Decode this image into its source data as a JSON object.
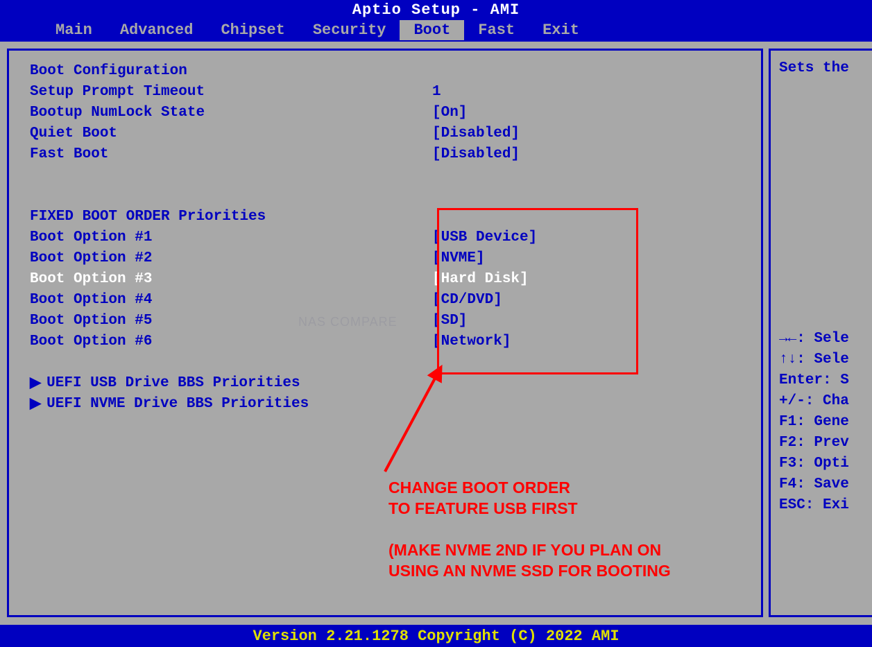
{
  "title": "Aptio Setup - AMI",
  "tabs": [
    "Main",
    "Advanced",
    "Chipset",
    "Security",
    "Boot",
    "Fast",
    "Exit"
  ],
  "active_tab": "Boot",
  "boot_config_title": "Boot Configuration",
  "settings": [
    {
      "label": "Setup Prompt Timeout",
      "value": "1"
    },
    {
      "label": "Bootup NumLock State",
      "value": "[On]"
    },
    {
      "label": "Quiet Boot",
      "value": "[Disabled]"
    },
    {
      "label": "Fast Boot",
      "value": "[Disabled]"
    }
  ],
  "fixed_boot_title": "FIXED BOOT ORDER Priorities",
  "boot_options": [
    {
      "label": "Boot Option #1",
      "value": "[USB Device]",
      "highlighted": false
    },
    {
      "label": "Boot Option #2",
      "value": "[NVME]",
      "highlighted": false
    },
    {
      "label": "Boot Option #3",
      "value": "[Hard Disk]",
      "highlighted": true
    },
    {
      "label": "Boot Option #4",
      "value": "[CD/DVD]",
      "highlighted": false
    },
    {
      "label": "Boot Option #5",
      "value": "[SD]",
      "highlighted": false
    },
    {
      "label": "Boot Option #6",
      "value": "[Network]",
      "highlighted": false
    }
  ],
  "submenus": [
    "UEFI USB Drive BBS Priorities",
    "UEFI NVME Drive BBS Priorities"
  ],
  "side_help": "Sets the",
  "help_keys": [
    "→←: Sele",
    "↑↓: Sele",
    "Enter: S",
    "+/-: Cha",
    "F1: Gene",
    "F2: Prev",
    "F3: Opti",
    "F4: Save",
    "ESC: Exi"
  ],
  "footer": "Version 2.21.1278 Copyright (C) 2022 AMI",
  "annotation_line1": "CHANGE BOOT ORDER",
  "annotation_line2": "TO FEATURE USB FIRST",
  "annotation_line3": "(MAKE NVME 2ND IF YOU PLAN ON",
  "annotation_line4": "USING AN NVME SSD FOR BOOTING",
  "watermark": "NAS COMPARE"
}
